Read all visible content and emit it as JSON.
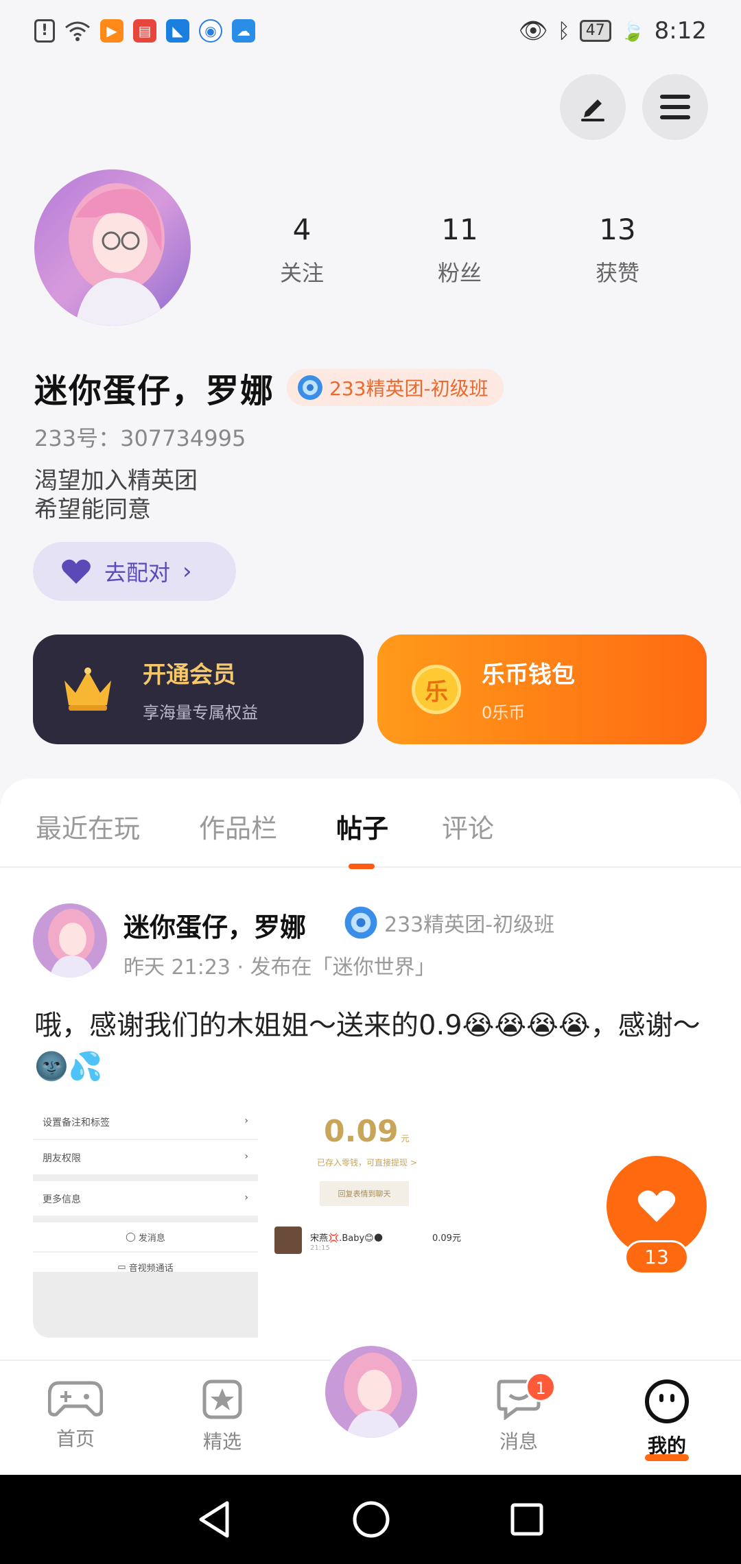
{
  "status_bar": {
    "time": "8:12",
    "battery": "47"
  },
  "profile": {
    "stats": [
      {
        "value": "4",
        "label": "关注"
      },
      {
        "value": "11",
        "label": "粉丝"
      },
      {
        "value": "13",
        "label": "获赞"
      }
    ],
    "username": "迷你蛋仔，罗娜",
    "badge": "233精英团-初级班",
    "uid": "233号：307734995",
    "bio_line1": "渴望加入精英团",
    "bio_line2": "希望能同意",
    "match_button": "去配对"
  },
  "cards": {
    "vip": {
      "title": "开通会员",
      "subtitle": "享海量专属权益",
      "crown_icon": "crown-icon"
    },
    "wallet": {
      "title": "乐币钱包",
      "subtitle": "0乐币",
      "coin_glyph": "乐"
    }
  },
  "tabs": [
    {
      "label": "最近在玩"
    },
    {
      "label": "作品栏"
    },
    {
      "label": "帖子"
    },
    {
      "label": "评论"
    }
  ],
  "post": {
    "author": "迷你蛋仔，罗娜",
    "badge": "233精英团-初级班",
    "meta": "昨天 21:23 · 发布在「迷你世界」",
    "text": "哦，感谢我们的木姐姐～送来的0.9😭😭😭😭，感谢～🌚💦",
    "image": {
      "settings_rows": [
        "设置备注和标签",
        "朋友权限",
        "更多信息"
      ],
      "send_message": "发消息",
      "video_call": "音视频通话",
      "amount": "0.09",
      "amount_unit": "元",
      "amount_note": "已存入零钱，可直接提现 >",
      "reply_button": "回复表情到聊天",
      "sender": "宋燕💢.Baby😊🌑",
      "sender_time": "21:15",
      "sender_amount": "0.09元"
    },
    "like_count": "13"
  },
  "bottom_nav": [
    {
      "label": "首页"
    },
    {
      "label": "精选"
    },
    {
      "label": "消息"
    },
    {
      "label": "我的"
    }
  ],
  "message_badge": "1",
  "colors": {
    "accent": "#ff6a10",
    "purple": "#5a49b7",
    "dark_card": "#2c2a3c"
  }
}
